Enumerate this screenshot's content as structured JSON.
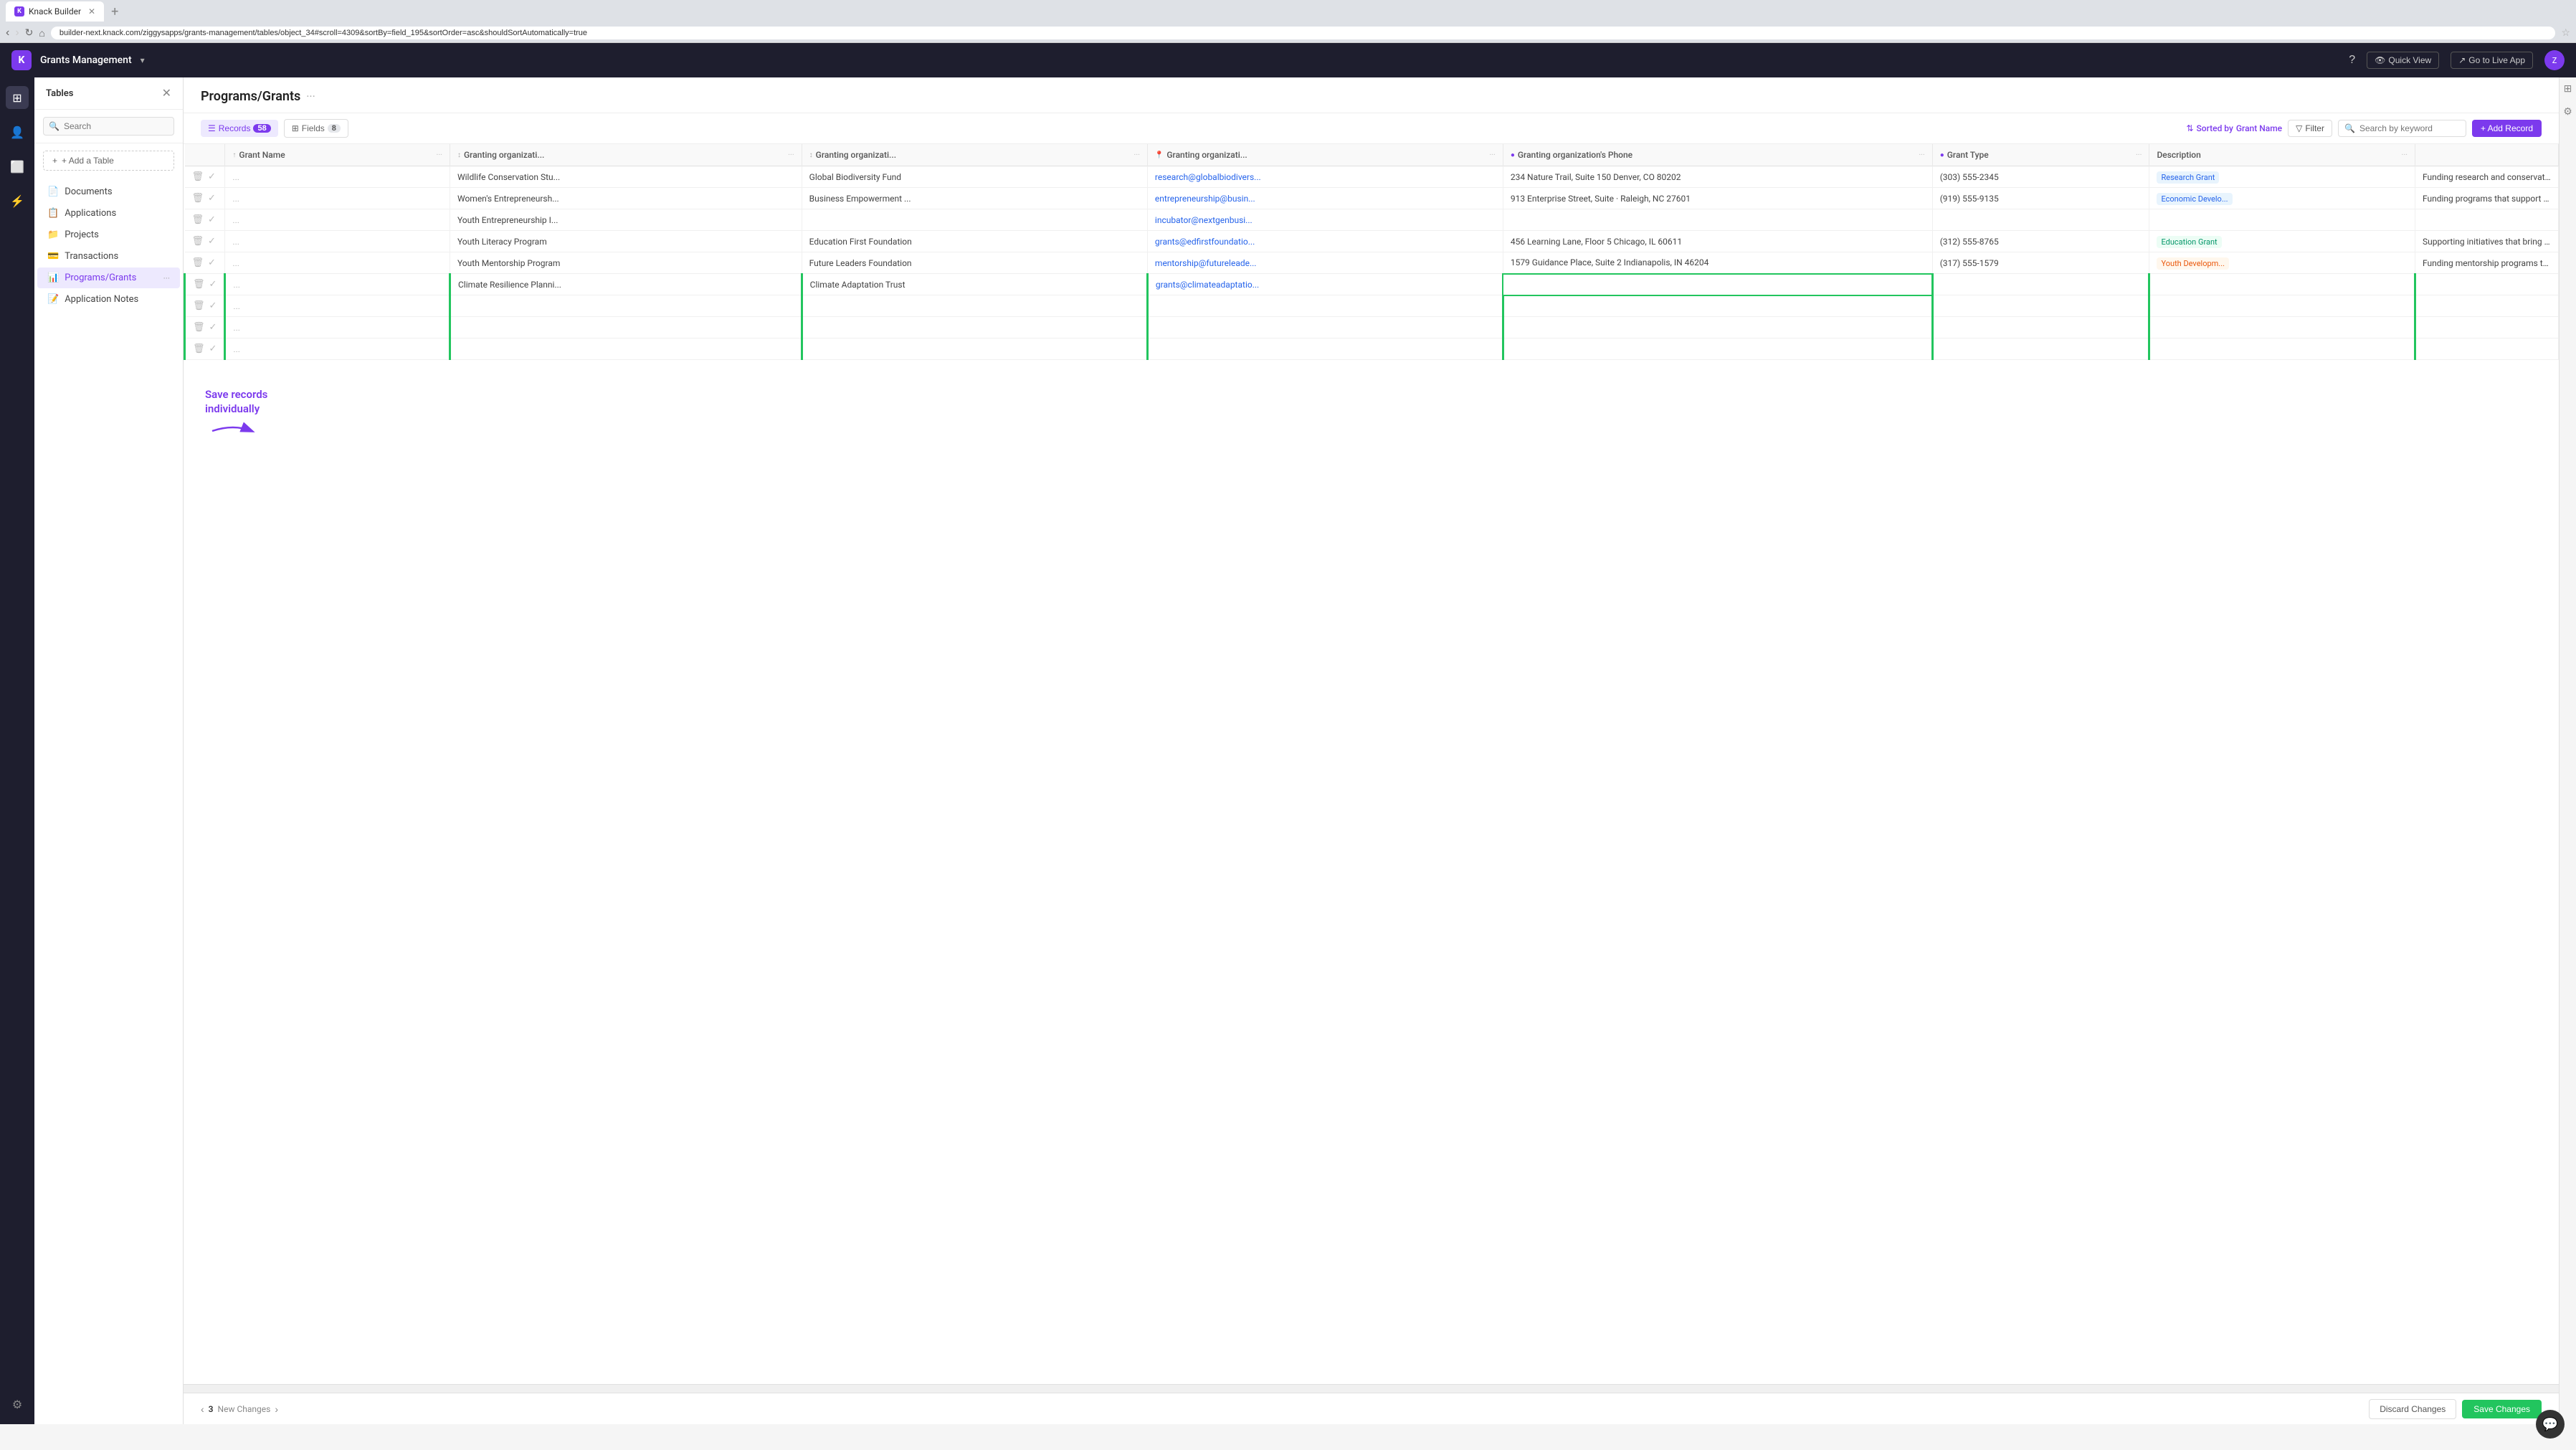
{
  "browser": {
    "tab_label": "Knack Builder",
    "url": "builder-next.knack.com/ziggysapps/grants-management/tables/object_34#scroll=4309&sortBy=field_195&sortOrder=asc&shouldSortAutomatically=true"
  },
  "app_header": {
    "logo_text": "K",
    "app_name": "Grants Management",
    "help_icon": "?",
    "quick_view_label": "Quick View",
    "live_app_label": "Go to Live App",
    "avatar_text": "Z"
  },
  "sidebar": {
    "title": "Tables",
    "search_placeholder": "Search",
    "add_table_label": "+ Add a Table",
    "items": [
      {
        "id": "documents",
        "label": "Documents",
        "icon": "📄"
      },
      {
        "id": "applications",
        "label": "Applications",
        "icon": "📋"
      },
      {
        "id": "projects",
        "label": "Projects",
        "icon": "📁"
      },
      {
        "id": "transactions",
        "label": "Transactions",
        "icon": "💳"
      },
      {
        "id": "programs-grants",
        "label": "Programs/Grants",
        "icon": "📊",
        "active": true
      },
      {
        "id": "application-notes",
        "label": "Application Notes",
        "icon": "📝"
      }
    ]
  },
  "content": {
    "title": "Programs/Grants",
    "toolbar": {
      "records_label": "Records",
      "records_count": "58",
      "fields_label": "Fields",
      "fields_count": "8",
      "sorted_by_label": "Sorted by",
      "sorted_by_value": "Grant Name",
      "filter_label": "Filter",
      "search_placeholder": "Search by keyword",
      "add_record_label": "+ Add Record"
    },
    "columns": [
      {
        "id": "grant-name",
        "label": "Grant Name"
      },
      {
        "id": "granting-org-1",
        "label": "Granting organizati..."
      },
      {
        "id": "granting-org-2",
        "label": "Granting organizati..."
      },
      {
        "id": "granting-org-3",
        "label": "Granting organizati..."
      },
      {
        "id": "granting-org-phone",
        "label": "Granting organization's Phone"
      },
      {
        "id": "grant-type",
        "label": "Grant Type"
      },
      {
        "id": "description",
        "label": "Description"
      }
    ],
    "rows": [
      {
        "id": "row1",
        "new": false,
        "grant_name": "Wildlife Conservation Stu...",
        "org1": "Global Biodiversity Fund",
        "org2": "research@globalbiodivers...",
        "org3": "234 Nature Trail, Suite 150 Denver, CO 80202",
        "phone": "(303) 555-2345",
        "grant_type": "Research Grant",
        "description": "Funding research and conservation efforts to protect wildlife and ..."
      },
      {
        "id": "row2",
        "new": false,
        "grant_name": "Women's Entrepreneursh...",
        "org1": "Business Empowerment ...",
        "org2": "entrepreneurship@busin...",
        "org3": "913 Enterprise Street, Suite · Raleigh, NC 27601",
        "phone": "(919) 555-9135",
        "grant_type": "Economic Develo...",
        "description": "Funding programs that support women entrepreneurs and ..."
      },
      {
        "id": "row3",
        "new": false,
        "grant_name": "Youth Entrepreneurship I...",
        "org1": "",
        "org2": "incubator@nextgenbusi...",
        "org3": "",
        "phone": "",
        "grant_type": "",
        "description": ""
      },
      {
        "id": "row4",
        "new": false,
        "grant_name": "Youth Literacy Program",
        "org1": "Education First Foundation",
        "org2": "grants@edfirstfoundatio...",
        "org3": "456 Learning Lane, Floor 5 Chicago, IL 60611",
        "phone": "(312) 555-8765",
        "grant_type": "Education Grant",
        "description": "Supporting initiatives that bring literacy and education for youth."
      },
      {
        "id": "row5",
        "new": false,
        "grant_name": "Youth Mentorship Program",
        "org1": "Future Leaders Foundation",
        "org2": "mentorship@futureleade...",
        "org3": "1579 Guidance Place, Suite 2 Indianapolis, IN 46204",
        "phone": "(317) 555-1579",
        "grant_type": "Youth Developm...",
        "description": "Funding mentorship programs that connect youth with positive role ..."
      },
      {
        "id": "row6",
        "new": true,
        "grant_name": "Climate Resilience Planni...",
        "org1": "Climate Adaptation Trust",
        "org2": "grants@climateadaptatio...",
        "org3": "",
        "phone": "",
        "grant_type": "",
        "description": ""
      },
      {
        "id": "row7",
        "new": true,
        "grant_name": "",
        "org1": "",
        "org2": "",
        "org3": "",
        "phone": "",
        "grant_type": "",
        "description": ""
      },
      {
        "id": "row8",
        "new": true,
        "grant_name": "",
        "org1": "",
        "org2": "",
        "org3": "",
        "phone": "",
        "grant_type": "",
        "description": ""
      },
      {
        "id": "row9",
        "new": true,
        "grant_name": "",
        "org1": "",
        "org2": "",
        "org3": "",
        "phone": "",
        "grant_type": "",
        "description": ""
      }
    ],
    "annotation": {
      "text": "Save records individually",
      "arrow": "→"
    }
  },
  "footer": {
    "new_changes_count": "3",
    "new_changes_label": "New Changes",
    "discard_label": "Discard Changes",
    "save_label": "Save Changes"
  },
  "chat": {
    "icon": "💬"
  }
}
